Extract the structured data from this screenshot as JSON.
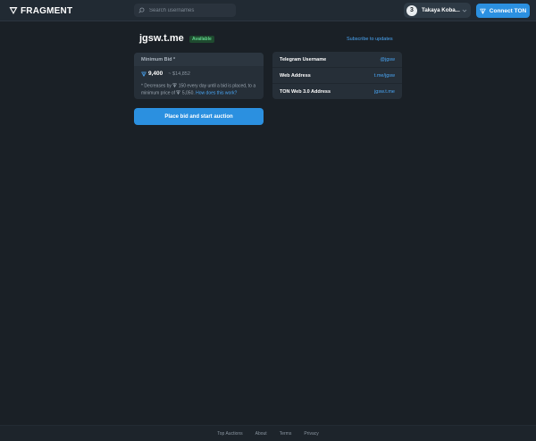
{
  "header": {
    "logo_text": "FRAGMENT",
    "search_placeholder": "Search usernames",
    "user_name": "Takaya Koba...",
    "avatar_letter": "3",
    "connect_label": "Connect TON"
  },
  "main": {
    "title": "jgsw.t.me",
    "status_badge": "Available",
    "subscribe_link": "Subscribe to updates"
  },
  "bid": {
    "header": "Minimum Bid *",
    "amount": "9,400",
    "usd": "~ $14,852",
    "note_part1": "* Decreases by ",
    "decrease_amount": "150",
    "note_part2": " every day until a bid is placed, to a minimum price of ",
    "minimum_price": "5,050",
    "note_part3": ". ",
    "how_link": "How does this work?",
    "button_label": "Place bid and start auction"
  },
  "info": {
    "rows": [
      {
        "label": "Telegram Username",
        "value": "@jgsw"
      },
      {
        "label": "Web Address",
        "value": "t.me/jgsw"
      },
      {
        "label": "TON Web 3.0 Address",
        "value": "jgsw.t.me"
      }
    ]
  },
  "footer": {
    "links": [
      "Top Auctions",
      "About",
      "Terms",
      "Privacy"
    ]
  },
  "colors": {
    "background": "#1a2026",
    "accent": "#2b90e0",
    "link": "#4aa6f5",
    "available": "#5fd38a"
  }
}
